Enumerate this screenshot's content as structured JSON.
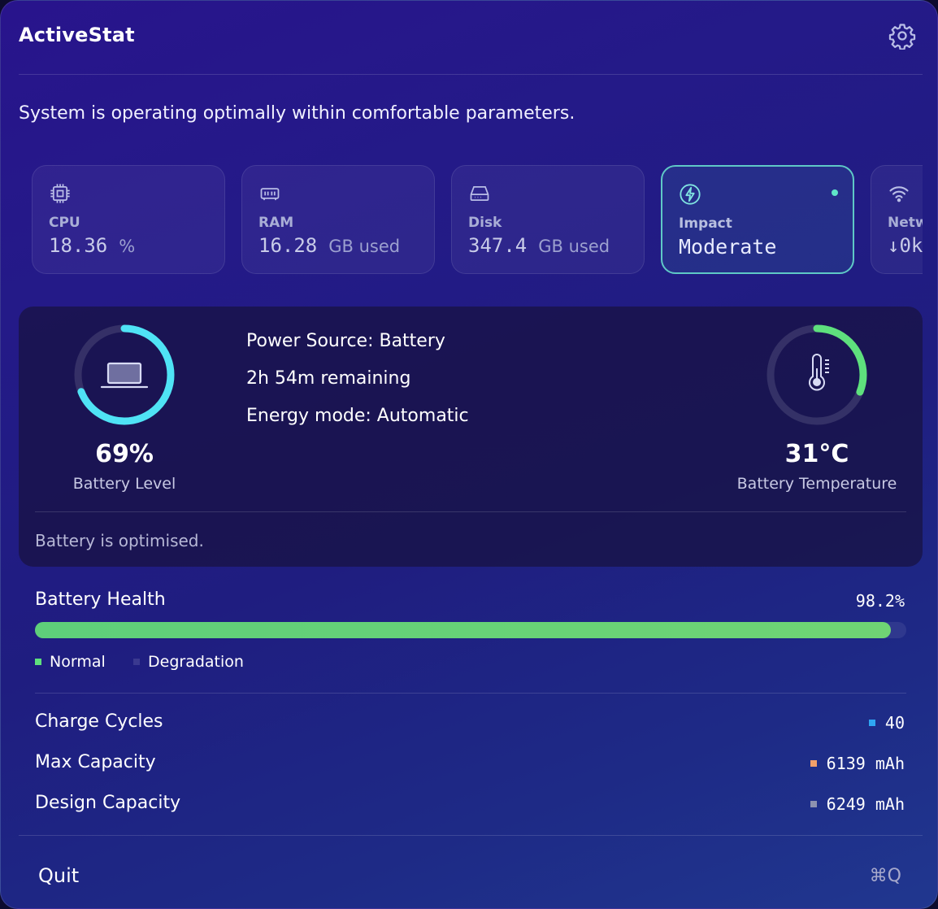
{
  "app": {
    "title": "ActiveStat",
    "status_message": "System is operating optimally within comfortable parameters."
  },
  "icons": [
    "gear-icon",
    "cpu-icon",
    "ram-icon",
    "disk-icon",
    "bolt-icon",
    "wifi-icon",
    "laptop-icon",
    "thermometer-icon"
  ],
  "cards": {
    "cpu": {
      "label": "CPU",
      "value": "18.36",
      "unit": "%"
    },
    "ram": {
      "label": "RAM",
      "value": "16.28",
      "unit": "GB used"
    },
    "disk": {
      "label": "Disk",
      "value": "347.4",
      "unit": "GB used"
    },
    "impact": {
      "label": "Impact",
      "value": "Moderate"
    },
    "network": {
      "label": "Netw",
      "value": "↓0k"
    }
  },
  "battery": {
    "level_text": "69%",
    "level": 0.69,
    "level_label": "Battery Level",
    "power_source": "Power Source: Battery",
    "remaining": "2h 54m remaining",
    "energy_mode": "Energy mode: Automatic",
    "temperature_text": "31°C",
    "temperature_fraction": 0.31,
    "temperature_label": "Battery Temperature",
    "note": "Battery is optimised."
  },
  "health": {
    "title": "Battery Health",
    "value_text": "98.2%",
    "value": 0.982,
    "legend_normal": "Normal",
    "legend_degradation": "Degradation"
  },
  "stats": {
    "charge_cycles_label": "Charge Cycles",
    "charge_cycles_value": "40",
    "max_capacity_label": "Max Capacity",
    "max_capacity_value": "6139 mAh",
    "design_capacity_label": "Design Capacity",
    "design_capacity_value": "6249 mAh"
  },
  "footer": {
    "quit_label": "Quit",
    "shortcut": "⌘Q"
  },
  "colors": {
    "accent_cyan": "#4fe3f5",
    "accent_green": "#5ecf7a",
    "card_active_border": "#5fc8c6",
    "cycles_swatch": "#2fa6f2",
    "max_swatch": "#f2a06a",
    "design_swatch": "#8d92b0"
  }
}
